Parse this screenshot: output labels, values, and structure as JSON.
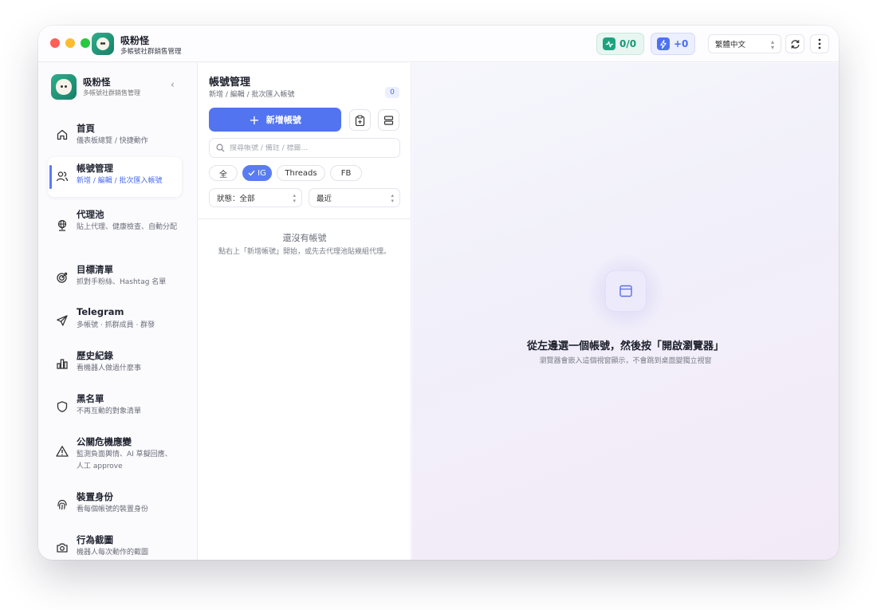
{
  "titlebar": {
    "app_name": "吸粉怪",
    "app_subtitle": "多帳號社群銷售管理",
    "health_value": "0/0",
    "boost_value": "+0",
    "language": "繁體中文"
  },
  "sidebar": {
    "app_name": "吸粉怪",
    "app_subtitle": "多帳號社群銷售管理",
    "collapse_glyph": "‹",
    "items": [
      {
        "title": "首頁",
        "desc": "儀表板總覽 / 快捷動作",
        "icon": "home-icon"
      },
      {
        "title": "帳號管理",
        "desc": "新增 / 編輯 / 批次匯入帳號",
        "icon": "users-icon",
        "active": true
      },
      {
        "title": "代理池",
        "desc": "貼上代理、健康檢查、自動分配",
        "icon": "globe-icon"
      },
      {
        "title": "目標清單",
        "desc": "抓對手粉絲、Hashtag 名單",
        "icon": "target-icon"
      },
      {
        "title": "Telegram",
        "desc": "多帳號 · 抓群成員 · 群發",
        "icon": "send-icon"
      },
      {
        "title": "歷史紀錄",
        "desc": "看機器人做過什麼事",
        "icon": "bar-chart-icon"
      },
      {
        "title": "黑名單",
        "desc": "不再互動的對象清單",
        "icon": "shield-icon"
      },
      {
        "title": "公關危機應變",
        "desc": "監測負面輿情、AI 草擬回應、人工 approve",
        "icon": "warning-icon"
      },
      {
        "title": "裝置身份",
        "desc": "看每個帳號的裝置身份",
        "icon": "fingerprint-icon"
      },
      {
        "title": "行為截圖",
        "desc": "機器人每次動作的截圖",
        "icon": "camera-icon"
      }
    ]
  },
  "accounts": {
    "title": "帳號管理",
    "subtitle": "新增 / 編輯 / 批次匯入帳號",
    "count": "0",
    "add_label": "新增帳號",
    "search_placeholder": "搜尋帳號 / 備註 / 標籤...",
    "filters": {
      "all": "全",
      "ig": "IG",
      "threads": "Threads",
      "fb": "FB"
    },
    "status_select": "狀態：全部",
    "sort_select": "最近",
    "empty_title": "還沒有帳號",
    "empty_desc": "點右上「新增帳號」開始，或先去代理池貼幾組代理。"
  },
  "browser_panel": {
    "title": "從左邊選一個帳號，然後按「開啟瀏覽器」",
    "desc": "瀏覽器會嵌入這個視窗顯示，不會跳到桌面變獨立視窗"
  },
  "colors": {
    "accent": "#5274f0",
    "success": "#1ea37f"
  }
}
